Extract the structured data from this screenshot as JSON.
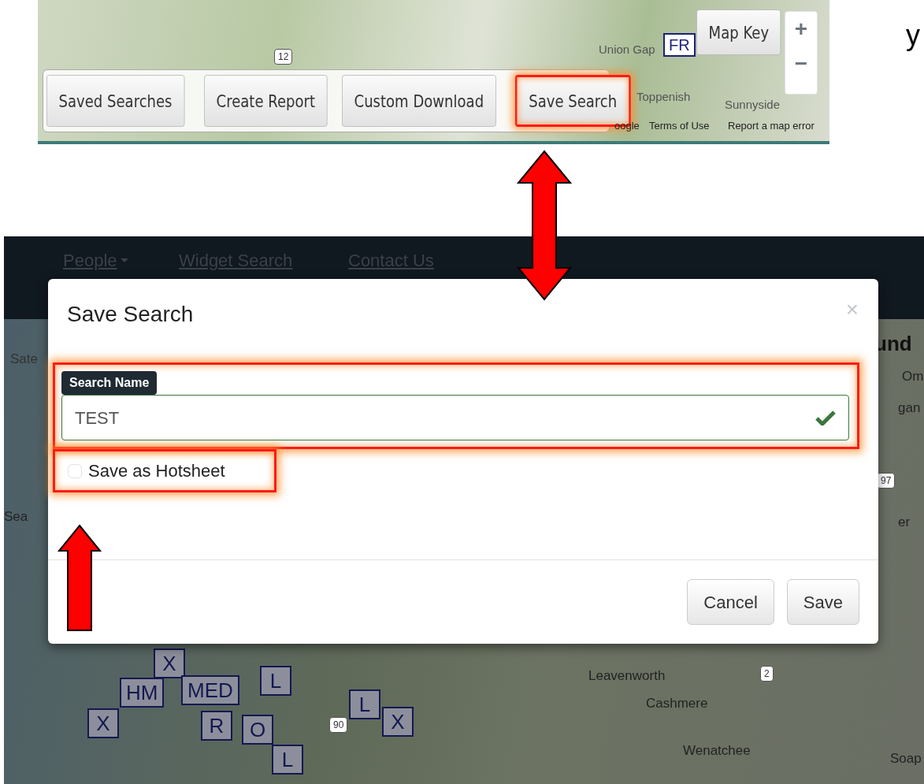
{
  "top_screenshot": {
    "map_labels": [
      "Union Gap",
      "Toppenish",
      "Sunnyside"
    ],
    "road_shield": "12",
    "marker": "FR",
    "map_key_button": "Map Key",
    "zoom_in": "+",
    "zoom_out": "−",
    "toolbar_buttons": [
      {
        "label": "Saved Searches",
        "highlighted": false
      },
      {
        "label": "Create Report",
        "highlighted": false
      },
      {
        "label": "Custom Download",
        "highlighted": false
      },
      {
        "label": "Save Search",
        "highlighted": true
      }
    ],
    "attribution": [
      "oogle",
      "Terms of Use",
      "Report a map error"
    ]
  },
  "side_text": "y",
  "bottom_screenshot": {
    "nav_items": [
      {
        "label": "People",
        "dropdown": true
      },
      {
        "label": "Widget Search",
        "dropdown": false
      },
      {
        "label": "Contact Us",
        "dropdown": false
      }
    ],
    "map_type_tab": "Sate",
    "panel_heading": "und",
    "map_labels": [
      "Om",
      "gan",
      "Sea",
      "er",
      "Leavenworth",
      "Cashmere",
      "Wenatchee",
      "Soap"
    ],
    "road_shields": [
      "97",
      "2",
      "90"
    ],
    "markers": [
      "X",
      "HM",
      "MED",
      "L",
      "X",
      "R",
      "O",
      "L",
      "L",
      "X"
    ],
    "modal": {
      "title": "Save Search",
      "close": "×",
      "field": {
        "label": "Search Name",
        "value": "TEST",
        "valid": true,
        "highlighted": true
      },
      "checkbox": {
        "label": "Save as Hotsheet",
        "checked": false,
        "highlighted": true
      },
      "buttons": [
        {
          "label": "Cancel"
        },
        {
          "label": "Save"
        }
      ]
    }
  }
}
